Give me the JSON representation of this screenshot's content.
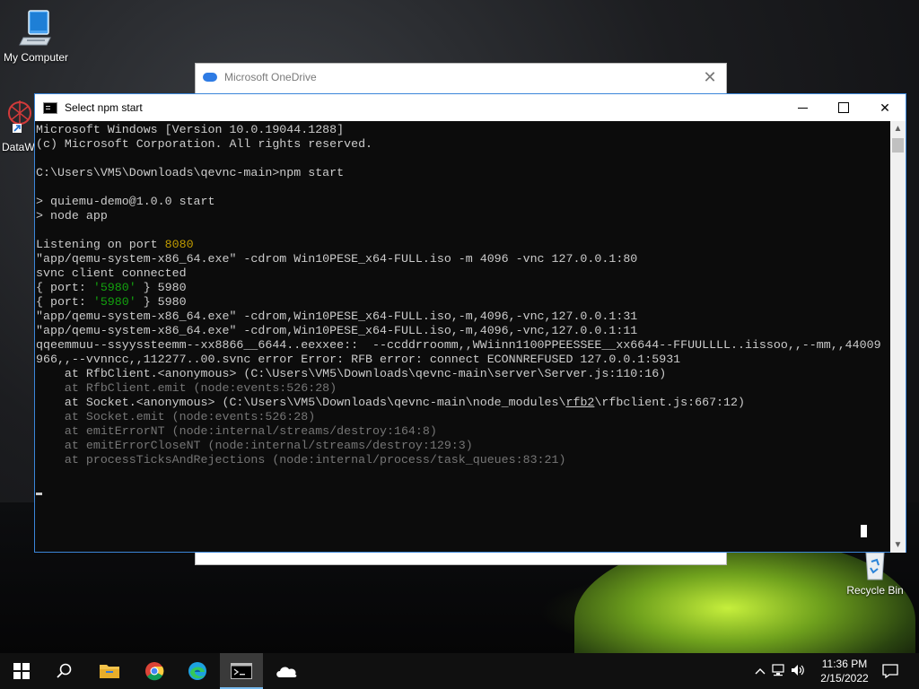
{
  "desktop": {
    "icons": [
      {
        "label": "My Computer",
        "icon": "monitor-icon"
      },
      {
        "label": "DataW",
        "icon": "app-shortcut-icon"
      },
      {
        "label": "Recycle Bin",
        "icon": "recycle-bin-icon"
      }
    ]
  },
  "onedrive": {
    "title": "Microsoft OneDrive",
    "close_glyph": "✕"
  },
  "console": {
    "title": "Select npm start",
    "buttons": {
      "minimize": "—",
      "maximize": "☐",
      "close": "✕"
    },
    "lines": [
      [
        {
          "t": "Microsoft Windows [Version 10.0.19044.1288]"
        }
      ],
      [
        {
          "t": "(c) Microsoft Corporation. All rights reserved."
        }
      ],
      [
        {
          "t": ""
        }
      ],
      [
        {
          "t": "C:\\Users\\VM5\\Downloads\\qevnc-main>npm start"
        }
      ],
      [
        {
          "t": ""
        }
      ],
      [
        {
          "t": "> quiemu-demo@1.0.0 start"
        }
      ],
      [
        {
          "t": "> node app"
        }
      ],
      [
        {
          "t": ""
        }
      ],
      [
        {
          "t": "Listening on port "
        },
        {
          "t": "8080",
          "c": "yellow"
        }
      ],
      [
        {
          "t": "\"app/qemu-system-x86_64.exe\" -cdrom Win10PESE_x64-FULL.iso -m 4096 -vnc 127.0.0.1:80"
        }
      ],
      [
        {
          "t": "svnc client connected"
        }
      ],
      [
        {
          "t": "{ port: "
        },
        {
          "t": "'5980'",
          "c": "green"
        },
        {
          "t": " } 5980"
        }
      ],
      [
        {
          "t": "{ port: "
        },
        {
          "t": "'5980'",
          "c": "green"
        },
        {
          "t": " } 5980"
        }
      ],
      [
        {
          "t": "\"app/qemu-system-x86_64.exe\" -cdrom,Win10PESE_x64-FULL.iso,-m,4096,-vnc,127.0.0.1:31"
        }
      ],
      [
        {
          "t": "\"app/qemu-system-x86_64.exe\" -cdrom,Win10PESE_x64-FULL.iso,-m,4096,-vnc,127.0.0.1:11"
        }
      ],
      [
        {
          "t": "qqeemmuu--ssyyssteemm--xx8866__6644..eexxee::  --ccddrroomm,,WWiinn1100PPEESSEE__xx6644--FFUULLLL..iissoo,,--mm,,44009"
        }
      ],
      [
        {
          "t": "966,,--vvnncc,,112277..00.svnc error Error: RFB error: connect ECONNREFUSED 127.0.0.1:5931"
        }
      ],
      [
        {
          "t": "    at RfbClient.<anonymous> (C:\\Users\\VM5\\Downloads\\qevnc-main\\server\\Server.js:110:16)"
        }
      ],
      [
        {
          "t": "    at RfbClient.emit (node:events:526:28)",
          "c": "gray"
        }
      ],
      [
        {
          "t": "    at Socket.<anonymous> (C:\\Users\\VM5\\Downloads\\qevnc-main\\node_modules\\"
        },
        {
          "t": "rfb2",
          "c": "under"
        },
        {
          "t": "\\rfbclient.js:667:12)"
        }
      ],
      [
        {
          "t": "    at Socket.emit (node:events:526:28)",
          "c": "gray"
        }
      ],
      [
        {
          "t": "    at emitErrorNT (node:internal/streams/destroy:164:8)",
          "c": "gray"
        }
      ],
      [
        {
          "t": "    at emitErrorCloseNT (node:internal/streams/destroy:129:3)",
          "c": "gray"
        }
      ],
      [
        {
          "t": "    at processTicksAndRejections (node:internal/process/task_queues:83:21)",
          "c": "gray"
        }
      ]
    ],
    "scrollbar": {
      "up": "▲",
      "down": "▼"
    }
  },
  "taskbar": {
    "items": [
      {
        "name": "start-button",
        "icon": "windows-logo-icon"
      },
      {
        "name": "search-button",
        "icon": "search-icon"
      },
      {
        "name": "file-explorer-button",
        "icon": "folder-icon"
      },
      {
        "name": "chrome-button",
        "icon": "chrome-icon"
      },
      {
        "name": "edge-button",
        "icon": "edge-icon"
      },
      {
        "name": "command-prompt-button",
        "icon": "terminal-icon",
        "active": true
      },
      {
        "name": "onedrive-button",
        "icon": "cloud-icon"
      }
    ],
    "tray": {
      "chevron": "^",
      "time": "11:36 PM",
      "date": "2/15/2022"
    }
  }
}
